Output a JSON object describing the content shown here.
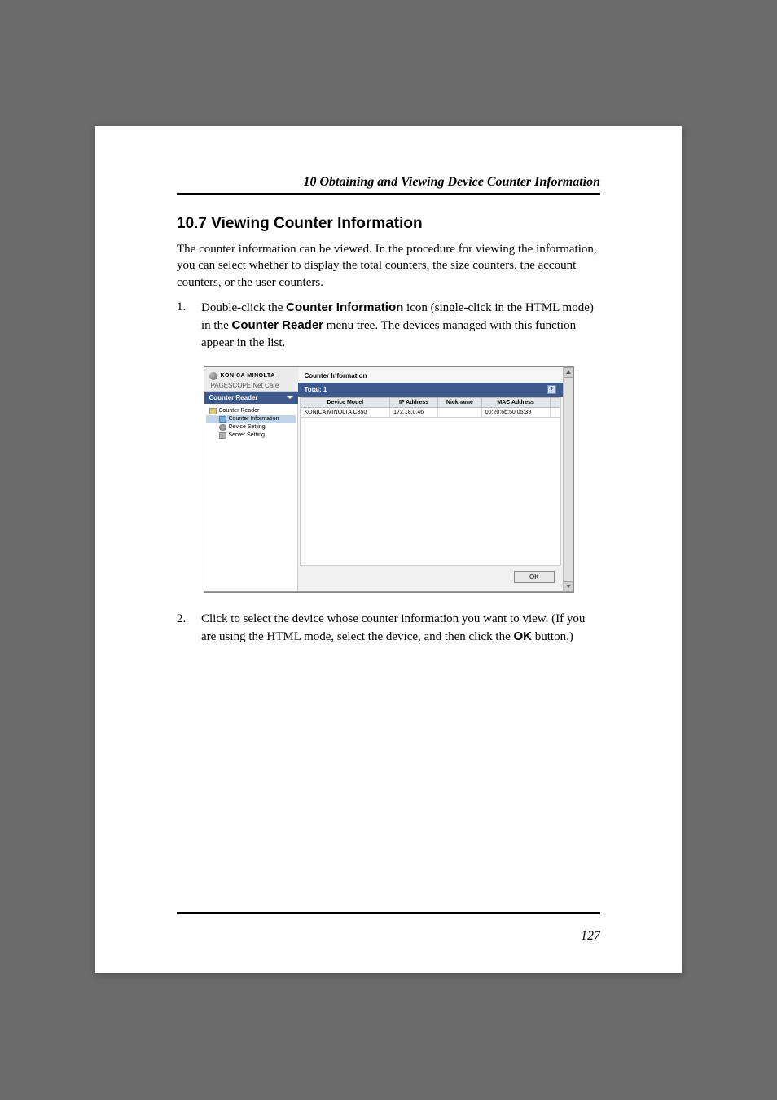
{
  "chapter": {
    "header": "10  Obtaining and Viewing Device Counter Information"
  },
  "section": {
    "title": "10.7 Viewing Counter Information",
    "intro": "The counter information can be viewed. In the procedure for viewing the information, you can select whether to display the total counters, the size counters, the account counters, or the user counters."
  },
  "steps": [
    {
      "number": "1.",
      "segments": [
        {
          "text": "Double-click the "
        },
        {
          "bold": "Counter Information"
        },
        {
          "text": " icon (single-click in the HTML mode) in the "
        },
        {
          "bold": "Counter Reader"
        },
        {
          "text": " menu tree. The devices managed with this function appear in the list."
        }
      ]
    },
    {
      "number": "2.",
      "segments": [
        {
          "text": "Click to select the device whose counter information you want to view. (If you are using the HTML mode, select the device, and then click the "
        },
        {
          "bold": "OK"
        },
        {
          "text": " button.)"
        }
      ]
    }
  ],
  "app": {
    "logo_brand": "KONICA MINOLTA",
    "logo_product": "PAGESCOPE Net Care",
    "sidebar_dropdown": "Counter Reader",
    "tree": {
      "root": "Counter Reader",
      "counter_info": "Counter Information",
      "device_setting": "Device Setting",
      "server_setting": "Server Setting"
    },
    "main_title": "Counter Information",
    "total_label": "Total: 1",
    "table": {
      "headers": {
        "device_model": "Device Model",
        "ip_address": "IP Address",
        "nickname": "Nickname",
        "mac_address": "MAC Address"
      },
      "rows": [
        {
          "device_model": "KONICA MINOLTA C350",
          "ip_address": "172.18.0.46",
          "nickname": "",
          "mac_address": "00:20:6b:50:05:39"
        }
      ]
    },
    "ok_button": "OK"
  },
  "page_number": "127"
}
